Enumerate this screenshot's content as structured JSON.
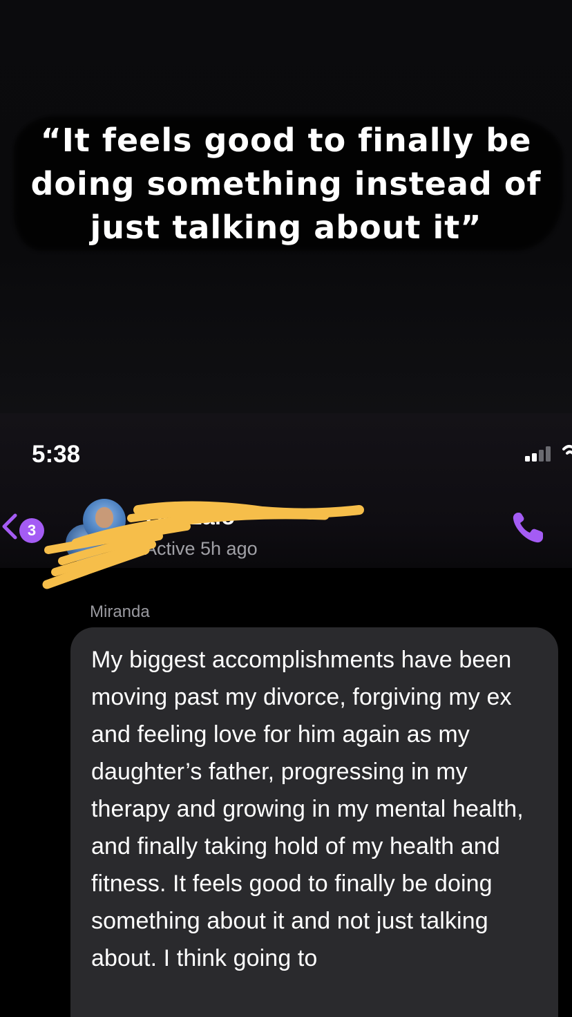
{
  "overlay": {
    "quote": "“It feels good to finally be doing something instead of just talking about it”"
  },
  "status_bar": {
    "time": "5:38"
  },
  "header": {
    "unread_count": "3",
    "contact_name": "Gonzalo",
    "contact_status": "Active 5h ago",
    "icons": [
      "back-chevron-icon",
      "call-icon",
      "signal-icon",
      "wifi-icon"
    ]
  },
  "conversation": {
    "sender": "Miranda",
    "message": "My biggest accomplishments have been moving past my divorce, forgiving my ex and feeling love for him again as my daughter’s father, progressing in my therapy and growing in my mental health, and finally taking hold of my health and fitness. It feels good to finally be doing something about it and not just talking about. I think going to"
  },
  "colors": {
    "accent": "#a45cf4",
    "bubble": "#2a2a2d",
    "redaction": "#f6be4a"
  }
}
